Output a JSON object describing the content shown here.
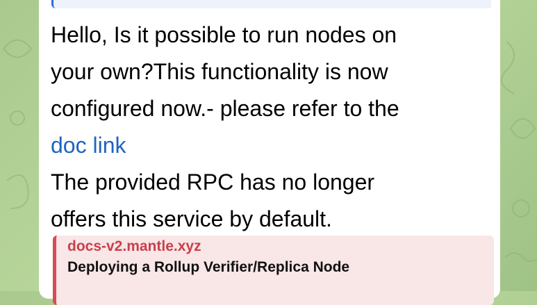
{
  "message": {
    "line1": "Hello, Is it possible to run nodes on",
    "line2": "your own?This functionality is now",
    "line3": "configured now.- please refer to the",
    "link_text": "doc link",
    "line5": "The provided RPC has no longer",
    "line6": "offers this service by default."
  },
  "link_preview": {
    "site": "docs-v2.mantle.xyz",
    "title": "Deploying a Rollup Verifier/Replica Node"
  },
  "colors": {
    "link": "#1f63c1",
    "preview_accent": "#d84a55",
    "reply_accent": "#2f6fd3",
    "wallpaper": "#b1d093"
  }
}
